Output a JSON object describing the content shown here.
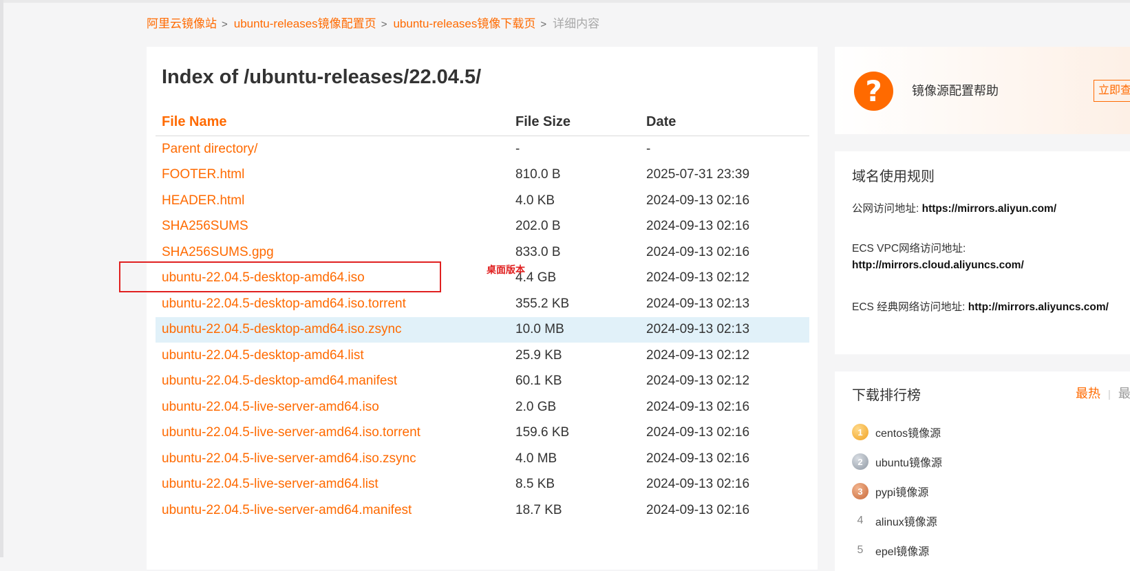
{
  "breadcrumb": {
    "items": [
      "阿里云镜像站",
      "ubuntu-releases镜像配置页",
      "ubuntu-releases镜像下载页"
    ],
    "current": "详细内容",
    "separator": ">"
  },
  "page_title": "Index of /ubuntu-releases/22.04.5/",
  "table": {
    "headers": {
      "name": "File Name",
      "size": "File Size",
      "date": "Date"
    },
    "rows": [
      {
        "name": "Parent directory/",
        "size": "-",
        "date": "-"
      },
      {
        "name": "FOOTER.html",
        "size": "810.0 B",
        "date": "2025-07-31 23:39"
      },
      {
        "name": "HEADER.html",
        "size": "4.0 KB",
        "date": "2024-09-13 02:16"
      },
      {
        "name": "SHA256SUMS",
        "size": "202.0 B",
        "date": "2024-09-13 02:16"
      },
      {
        "name": "SHA256SUMS.gpg",
        "size": "833.0 B",
        "date": "2024-09-13 02:16"
      },
      {
        "name": "ubuntu-22.04.5-desktop-amd64.iso",
        "size": "4.4 GB",
        "date": "2024-09-13 02:12"
      },
      {
        "name": "ubuntu-22.04.5-desktop-amd64.iso.torrent",
        "size": "355.2 KB",
        "date": "2024-09-13 02:13"
      },
      {
        "name": "ubuntu-22.04.5-desktop-amd64.iso.zsync",
        "size": "10.0 MB",
        "date": "2024-09-13 02:13"
      },
      {
        "name": "ubuntu-22.04.5-desktop-amd64.list",
        "size": "25.9 KB",
        "date": "2024-09-13 02:12"
      },
      {
        "name": "ubuntu-22.04.5-desktop-amd64.manifest",
        "size": "60.1 KB",
        "date": "2024-09-13 02:12"
      },
      {
        "name": "ubuntu-22.04.5-live-server-amd64.iso",
        "size": "2.0 GB",
        "date": "2024-09-13 02:16"
      },
      {
        "name": "ubuntu-22.04.5-live-server-amd64.iso.torrent",
        "size": "159.6 KB",
        "date": "2024-09-13 02:16"
      },
      {
        "name": "ubuntu-22.04.5-live-server-amd64.iso.zsync",
        "size": "4.0 MB",
        "date": "2024-09-13 02:16"
      },
      {
        "name": "ubuntu-22.04.5-live-server-amd64.list",
        "size": "8.5 KB",
        "date": "2024-09-13 02:16"
      },
      {
        "name": "ubuntu-22.04.5-live-server-amd64.manifest",
        "size": "18.7 KB",
        "date": "2024-09-13 02:16"
      }
    ],
    "highlighted_row_index": 7
  },
  "annotation": {
    "label": "桌面版本",
    "target_row_index": 5
  },
  "help": {
    "icon": "question-icon",
    "text": "镜像源配置帮助",
    "button_label": "立即查"
  },
  "domain_rules": {
    "title": "域名使用规则",
    "public_label": "公网访问地址:",
    "public_url": "https://mirrors.aliyun.com/",
    "vpc_label": "ECS VPC网络访问地址:",
    "vpc_url": "http://mirrors.cloud.aliyuncs.com/",
    "classic_label": "ECS 经典网络访问地址:",
    "classic_url": "http://mirrors.aliyuncs.com/"
  },
  "ranking": {
    "title": "下载排行榜",
    "tabs": [
      "最热",
      "最"
    ],
    "items": [
      {
        "rank": "1",
        "name": "centos镜像源"
      },
      {
        "rank": "2",
        "name": "ubuntu镜像源"
      },
      {
        "rank": "3",
        "name": "pypi镜像源"
      },
      {
        "rank": "4",
        "name": "alinux镜像源"
      },
      {
        "rank": "5",
        "name": "epel镜像源"
      }
    ]
  },
  "colors": {
    "accent": "#ff6a00",
    "annotation_red": "#e02020",
    "row_highlight": "#e1f1f9",
    "breadcrumb_current": "#a8a8a8"
  }
}
